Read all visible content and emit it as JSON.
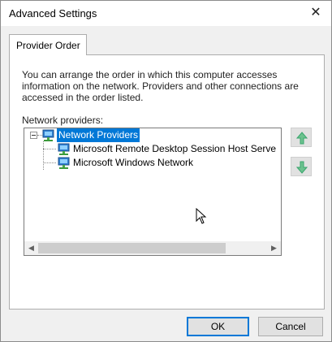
{
  "window": {
    "title": "Advanced Settings",
    "close_glyph": "✕"
  },
  "tabs": [
    {
      "label": "Provider Order",
      "selected": true
    }
  ],
  "description": "You can arrange the order in which this computer accesses information on the network.  Providers and other connections are accessed in the order listed.",
  "network_providers_label": "Network providers:",
  "tree": {
    "root": {
      "label": "Network Providers",
      "expanded": true,
      "selected": true,
      "icon": "network-icon"
    },
    "children": [
      {
        "label": "Microsoft Remote Desktop Session Host Serve",
        "icon": "network-icon"
      },
      {
        "label": "Microsoft Windows Network",
        "icon": "network-icon"
      }
    ]
  },
  "scrollbar": {
    "left_glyph": "◀",
    "right_glyph": "▶"
  },
  "move_buttons": {
    "up_icon": "move-up-icon",
    "down_icon": "move-down-icon"
  },
  "colors": {
    "selection": "#0078d7",
    "arrow_green": "#3aa66e",
    "default_button_border": "#0078d7"
  },
  "buttons": {
    "ok": "OK",
    "cancel": "Cancel"
  }
}
